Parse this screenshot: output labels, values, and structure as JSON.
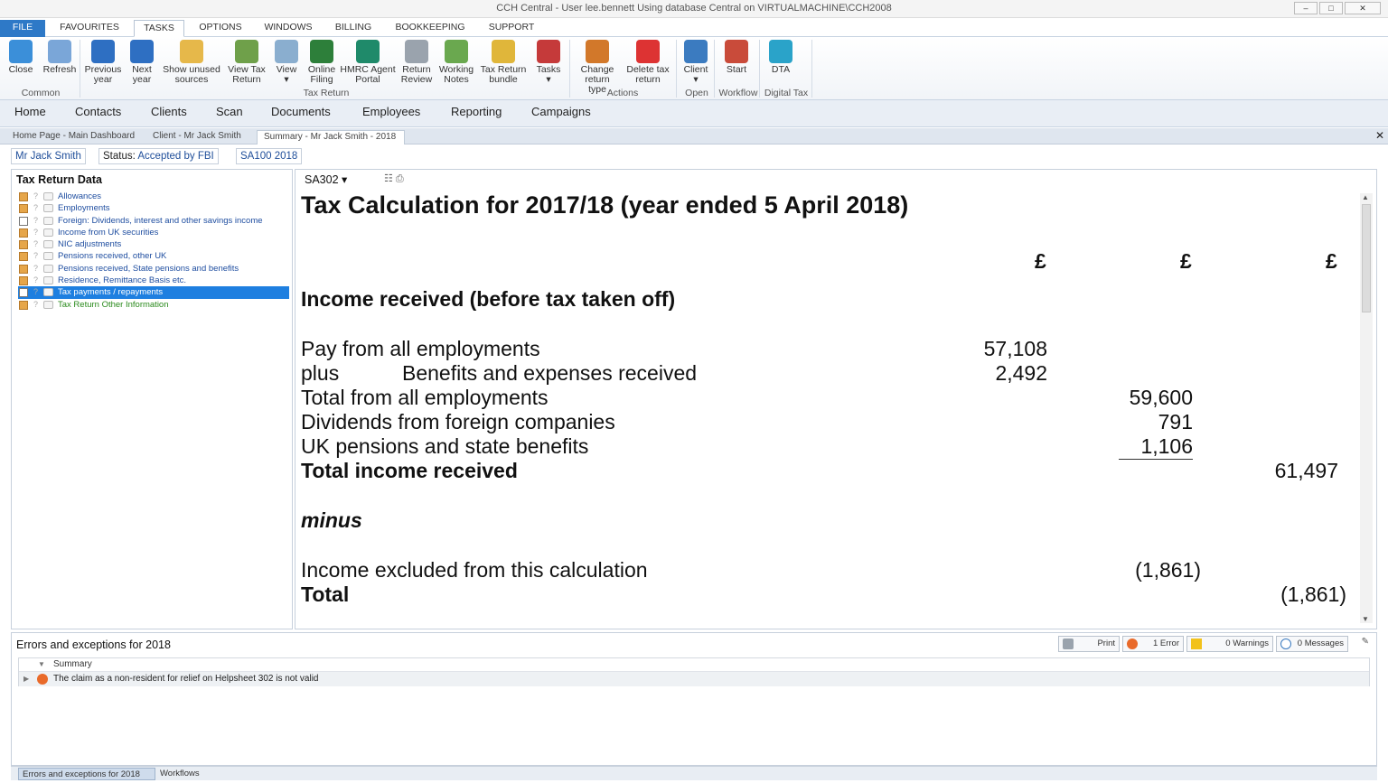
{
  "window": {
    "title": "CCH Central - User lee.bennett Using database Central on VIRTUALMACHINE\\CCH2008",
    "min": "–",
    "max": "□",
    "close": "✕"
  },
  "menu": {
    "tabs": [
      "FILE",
      "FAVOURITES",
      "TASKS",
      "OPTIONS",
      "WINDOWS",
      "BILLING",
      "BOOKKEEPING",
      "SUPPORT"
    ],
    "active": "TASKS"
  },
  "ribbon": {
    "buttons": [
      {
        "label": "Close",
        "label2": "",
        "icon": "close-window-icon",
        "color": "#3b8fd9"
      },
      {
        "label": "Refresh",
        "label2": "",
        "icon": "refresh-icon",
        "color": "#7aa6d8"
      },
      {
        "label": "Previous",
        "label2": "year",
        "icon": "arrow-left-icon",
        "color": "#2e6fc2"
      },
      {
        "label": "Next",
        "label2": "year",
        "icon": "arrow-right-icon",
        "color": "#2e6fc2"
      },
      {
        "label": "Show unused",
        "label2": "sources",
        "icon": "folder-icon",
        "color": "#e6b84a"
      },
      {
        "label": "View Tax",
        "label2": "Return",
        "icon": "document-icon",
        "color": "#6fa04a"
      },
      {
        "label": "View",
        "label2": "▾",
        "icon": "magnifier-icon",
        "color": "#8aaecf"
      },
      {
        "label": "Online",
        "label2": "Filing",
        "icon": "globe-icon",
        "color": "#2d7f3a"
      },
      {
        "label": "HMRC Agent",
        "label2": "Portal",
        "icon": "crown-icon",
        "color": "#1f8a6a"
      },
      {
        "label": "Return",
        "label2": "Review",
        "icon": "review-icon",
        "color": "#9aa3ad"
      },
      {
        "label": "Working",
        "label2": "Notes",
        "icon": "notes-icon",
        "color": "#6aa84f"
      },
      {
        "label": "Tax Return",
        "label2": "bundle",
        "icon": "bundle-icon",
        "color": "#e0b63a"
      },
      {
        "label": "Tasks",
        "label2": "▾",
        "icon": "tasks-icon",
        "color": "#c53a3a"
      },
      {
        "label": "Change",
        "label2": "return type",
        "icon": "change-icon",
        "color": "#d2782a"
      },
      {
        "label": "Delete tax",
        "label2": "return",
        "icon": "delete-icon",
        "color": "#d33"
      },
      {
        "label": "Client",
        "label2": "▾",
        "icon": "client-icon",
        "color": "#3b7bc0"
      },
      {
        "label": "Start",
        "label2": "",
        "icon": "workflow-icon",
        "color": "#c94b3a"
      },
      {
        "label": "DTA",
        "label2": "",
        "icon": "dta-crown-icon",
        "color": "#2aa3c9"
      }
    ],
    "groups": [
      "Common",
      "Tax Return",
      "Actions",
      "Open",
      "Workflow",
      "Digital Tax"
    ]
  },
  "nav": [
    "Home",
    "Contacts",
    "Clients",
    "Scan",
    "Documents",
    "Employees",
    "Reporting",
    "Campaigns"
  ],
  "doc_tabs": [
    "Home Page - Main Dashboard",
    "Client - Mr Jack Smith",
    "Summary - Mr Jack Smith - 2018"
  ],
  "doc_close": "✕",
  "info": {
    "client": "Mr Jack Smith",
    "status_label": "Status:",
    "status_value": "Accepted by FBI",
    "return": "SA100 2018"
  },
  "left": {
    "heading": "Tax Return Data",
    "items": [
      "Allowances",
      "Employments",
      "Foreign: Dividends, interest and other savings income",
      "Income from UK securities",
      "NIC adjustments",
      "Pensions received, other UK",
      "Pensions received, State pensions and benefits",
      "Residence, Remittance Basis etc.",
      "Tax payments / repayments",
      "Tax Return Other Information"
    ],
    "q": "?"
  },
  "sheet": {
    "selector": "SA302 ▾",
    "title": "Tax Calculation for 2017/18 (year ended 5 April 2018)",
    "currency": "£",
    "section": "Income received (before tax taken off)",
    "rows": {
      "pay_label": "Pay from all employments",
      "pay_value": "57,108",
      "plus": "plus",
      "benefits_label": "Benefits and expenses received",
      "benefits_value": "2,492",
      "total_emp_label": "Total from all employments",
      "total_emp_value": "59,600",
      "div_label": "Dividends from foreign companies",
      "div_value": "791",
      "pens_label": "UK pensions and state benefits",
      "pens_value": "1,106",
      "total_income_label": "Total income received",
      "total_income_value": "61,497",
      "minus": "minus",
      "excl_label": "Income excluded from this calculation",
      "excl_value": "(1,861)",
      "total_label": "Total",
      "total_value": "(1,861)"
    }
  },
  "errors": {
    "heading": "Errors and exceptions for 2018",
    "print": "Print",
    "error_count": "1 Error",
    "warnings": "0 Warnings",
    "messages": "0 Messages",
    "col_summary": "Summary",
    "row": "The claim as a non-resident for relief on Helpsheet 302 is not valid"
  },
  "bottom_tabs": [
    "Errors and exceptions for 2018",
    "Workflows"
  ]
}
